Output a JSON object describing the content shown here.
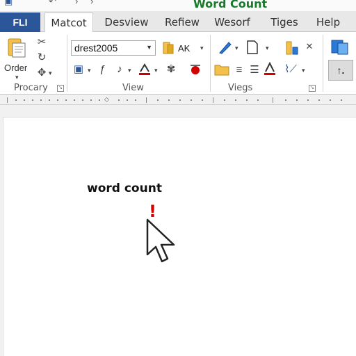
{
  "window": {
    "title": "Word Count"
  },
  "tabs": [
    {
      "label": "FLI"
    },
    {
      "label": "Matcot"
    },
    {
      "label": "Desview"
    },
    {
      "label": "Refiew"
    },
    {
      "label": "Wesorf"
    },
    {
      "label": "Tiges"
    },
    {
      "label": "Help"
    }
  ],
  "ribbon": {
    "order_label": "Order",
    "font_name": "drest2005",
    "ak_label": "AK",
    "groups": [
      "Procary",
      "View",
      "Viegs"
    ],
    "pressed_button": "↑."
  },
  "document": {
    "text": "word count",
    "alert_mark": "!"
  },
  "colors": {
    "accent": "#2b579a",
    "title": "#1a7a2c",
    "alert": "#d40000"
  }
}
